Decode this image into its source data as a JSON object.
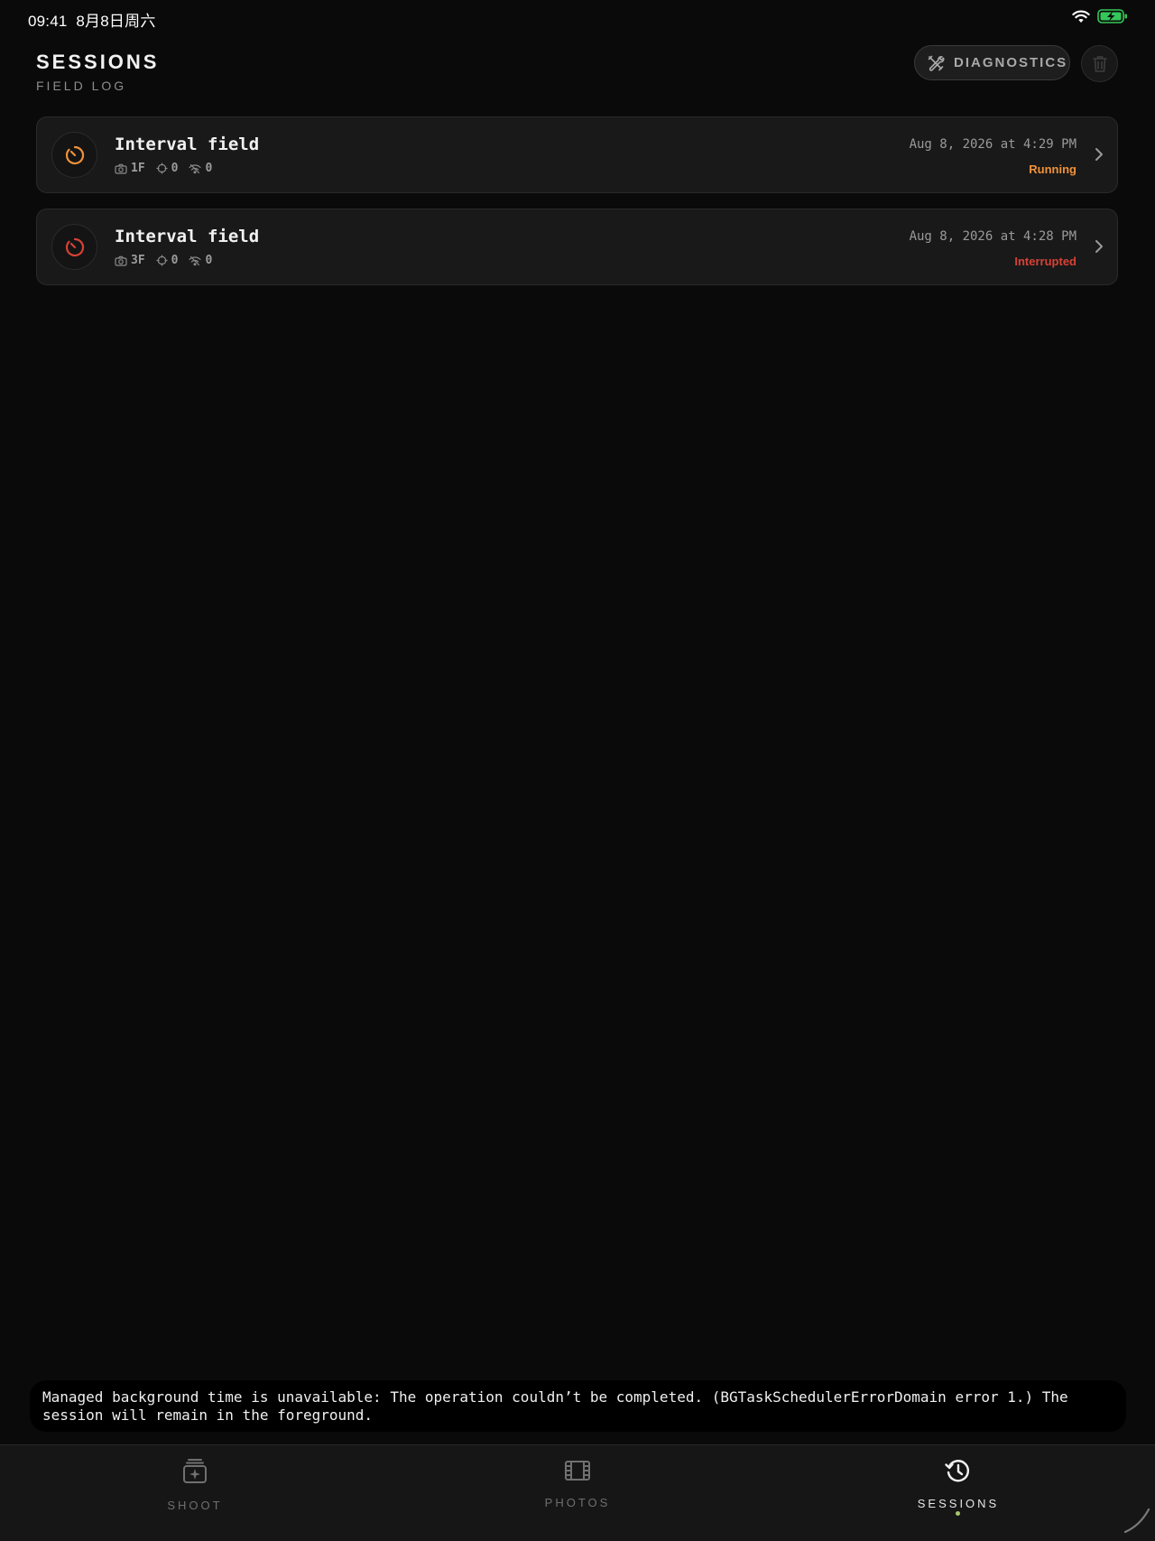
{
  "status_bar": {
    "time": "09:41",
    "date": "8月8日周六",
    "battery_color": "#34c759"
  },
  "header": {
    "title": "SESSIONS",
    "subtitle": "FIELD LOG",
    "diagnostics_label": "DIAGNOSTICS"
  },
  "sessions": [
    {
      "name": "Interval field",
      "frames": "1F",
      "targets": "0",
      "signal": "0",
      "date": "Aug 8, 2026 at 4:29 PM",
      "status": "Running",
      "status_color": "#f0923a"
    },
    {
      "name": "Interval field",
      "frames": "3F",
      "targets": "0",
      "signal": "0",
      "date": "Aug 8, 2026 at 4:28 PM",
      "status": "Interrupted",
      "status_color": "#d64236"
    }
  ],
  "toast": {
    "message": "Managed background time is unavailable: The operation couldn’t be completed. (BGTaskSchedulerErrorDomain error 1.) The session will remain in the foreground."
  },
  "tabs": [
    {
      "label": "SHOOT",
      "icon": "shoot-icon",
      "active": false
    },
    {
      "label": "PHOTOS",
      "icon": "film-icon",
      "active": false
    },
    {
      "label": "SESSIONS",
      "icon": "history-icon",
      "active": true
    }
  ],
  "colors": {
    "accent_active_dot": "#a6c66a",
    "running": "#f0923a",
    "interrupted": "#d64236"
  }
}
